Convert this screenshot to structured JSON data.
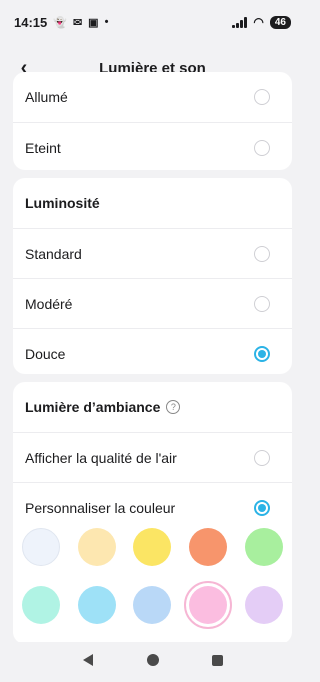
{
  "status_bar": {
    "time": "14:15",
    "battery": "46",
    "notification_icons": [
      "snapchat-icon",
      "gmail-icon",
      "app-icon",
      "dot-icon"
    ]
  },
  "header": {
    "title": "Lumière et son"
  },
  "card1": {
    "rows": [
      {
        "label": "Allumé",
        "selected": false
      },
      {
        "label": "Eteint",
        "selected": false
      }
    ]
  },
  "card2": {
    "title": "Luminosité",
    "rows": [
      {
        "label": "Standard",
        "selected": false
      },
      {
        "label": "Modéré",
        "selected": false
      },
      {
        "label": "Douce",
        "selected": true
      }
    ]
  },
  "card3": {
    "title": "Lumière d’ambiance",
    "rows": [
      {
        "label": "Afficher la qualité de l'air",
        "selected": false
      },
      {
        "label": "Personnaliser la couleur",
        "selected": true
      }
    ]
  },
  "swatches": [
    {
      "color": "#eef3fb",
      "selected": false
    },
    {
      "color": "#fde7b0",
      "selected": false
    },
    {
      "color": "#fbe564",
      "selected": false
    },
    {
      "color": "#f7956c",
      "selected": false
    },
    {
      "color": "#a8ef9e",
      "selected": false
    },
    {
      "color": "#b0f3e4",
      "selected": false
    },
    {
      "color": "#9ee1f7",
      "selected": false
    },
    {
      "color": "#b9d8f7",
      "selected": false
    },
    {
      "color": "#fbbde0",
      "selected": true
    },
    {
      "color": "#e4cdf6",
      "selected": false
    }
  ],
  "accent_color": "#2bb3e6"
}
